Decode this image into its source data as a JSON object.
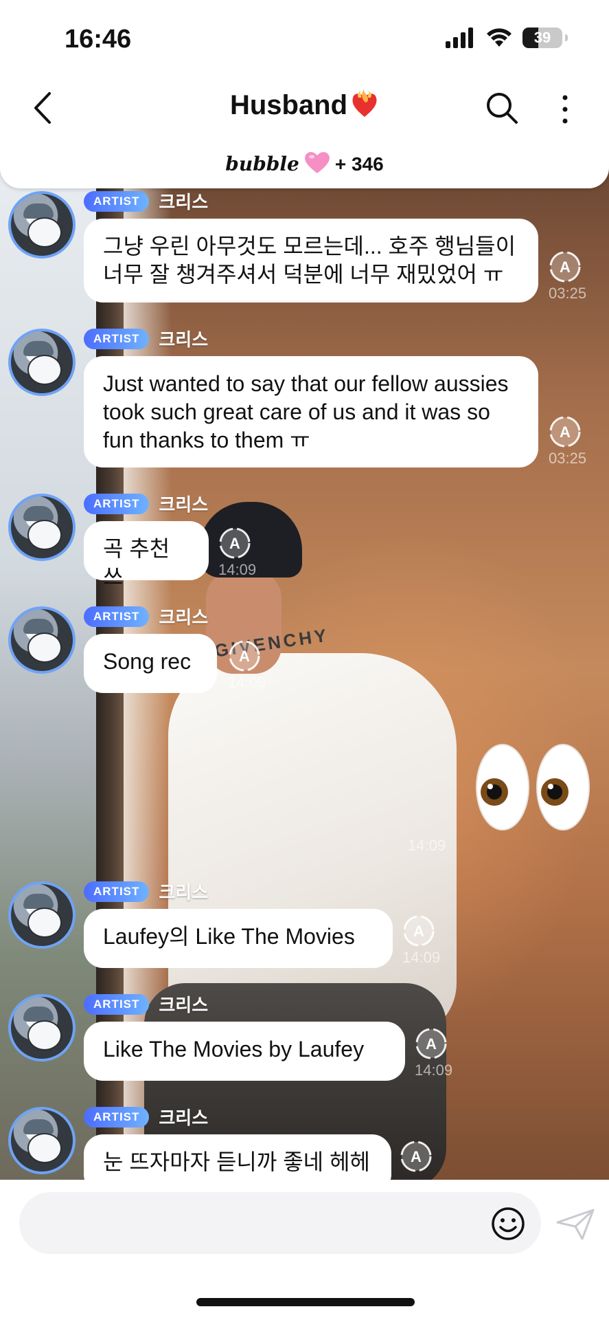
{
  "status_bar": {
    "time": "16:46",
    "battery": "39",
    "battery_level": 0.39
  },
  "header": {
    "title": "Husband",
    "brand": "bubble",
    "subscribers": "+ 346"
  },
  "messages": [
    {
      "badge": "ARTIST",
      "sender": "크리스",
      "text": "그냥 우린 아무것도 모르는데... 호주 행님들이 너무 잘 챙겨주셔서 덕분에 너무 재밌었어 ㅠ",
      "time": "03:25"
    },
    {
      "badge": "ARTIST",
      "sender": "크리스",
      "text": "Just wanted to say that our fellow aussies took such great care of us and it was so fun thanks to them ㅠ",
      "time": "03:25"
    },
    {
      "badge": "ARTIST",
      "sender": "크리스",
      "text": "곡 추천쓰",
      "time": "14:09"
    },
    {
      "badge": "ARTIST",
      "sender": "크리스",
      "text": "Song rec",
      "time": "14:09"
    },
    {
      "badge": "ARTIST",
      "sender": "크리스",
      "text": "Laufey의 Like The Movies",
      "time": "14:09"
    },
    {
      "badge": "ARTIST",
      "sender": "크리스",
      "text": "Like The Movies by Laufey",
      "time": "14:09"
    },
    {
      "badge": "ARTIST",
      "sender": "크리스",
      "text": "눈 뜨자마자 듣니까 좋네 헤헤",
      "time": ""
    }
  ],
  "eyes_message": {
    "emoji": "eyes-emoji",
    "time": "14:09"
  },
  "background": {
    "shirt_text": "GIVENCHY"
  },
  "input": {
    "value": "",
    "placeholder": ""
  },
  "colors": {
    "artist_badge": "#4c6dff",
    "avatar_ring": "#6fa3f5"
  }
}
